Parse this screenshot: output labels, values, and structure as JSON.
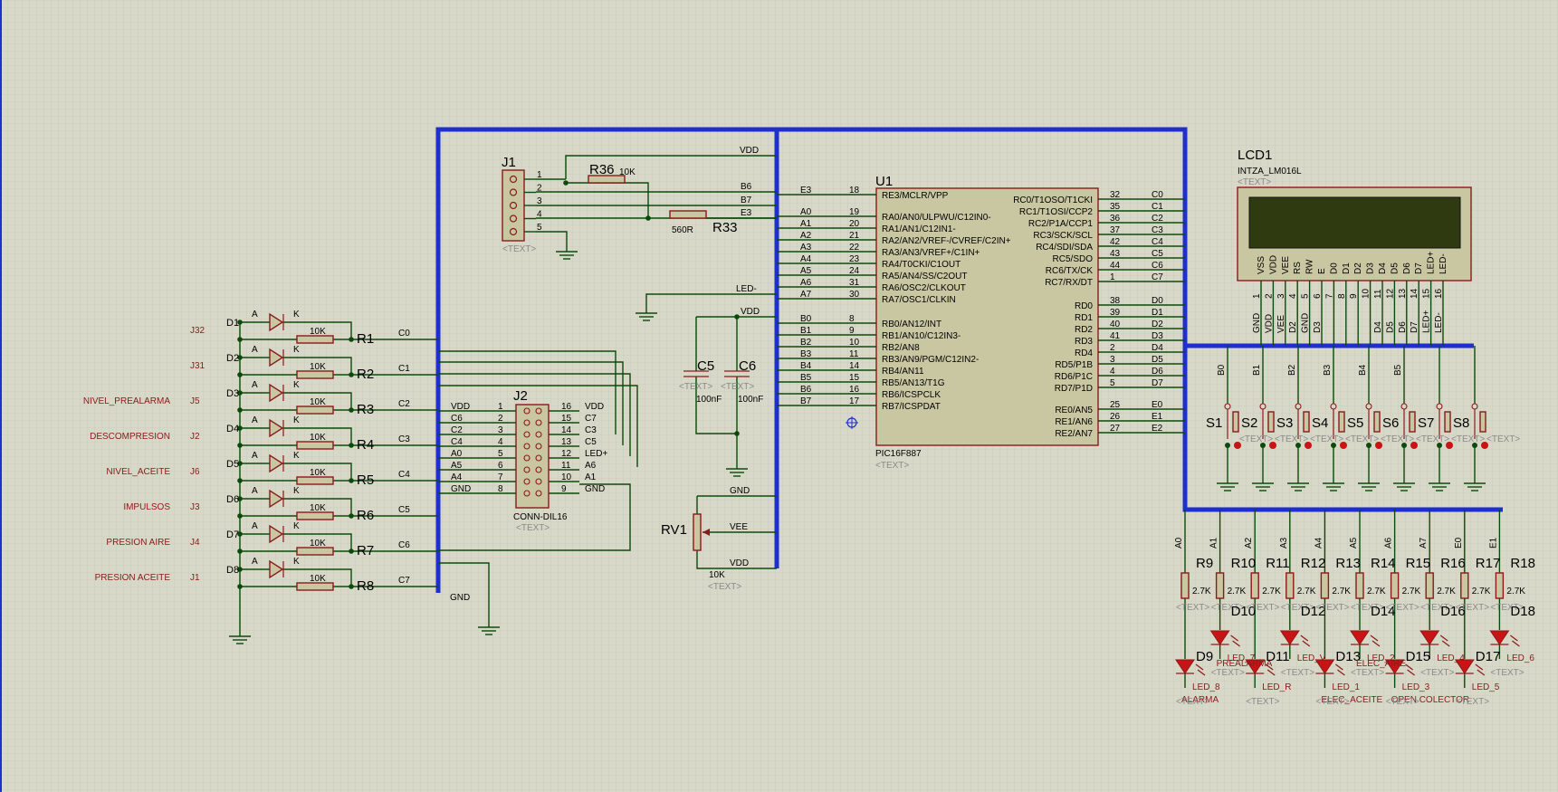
{
  "colors": {
    "background": "#d8d8c8",
    "grid": "#c3c3b3",
    "wire": "#0c4a0c",
    "bus": "#1f2fcf",
    "component": "#8b1a1a",
    "component_fill": "#c9c7a2",
    "lcd_screen": "#2f3a10",
    "label": "#8b1a1a"
  },
  "placeholder": "<TEXT>",
  "u1": {
    "ref": "U1",
    "part": "PIC16F887",
    "left_pins": [
      {
        "num": "18",
        "name": "RE3/MCLR/VPP",
        "net": "E3"
      },
      {
        "num": "19",
        "name": "RA0/AN0/ULPWU/C12IN0-",
        "net": "A0"
      },
      {
        "num": "20",
        "name": "RA1/AN1/C12IN1-",
        "net": "A1"
      },
      {
        "num": "21",
        "name": "RA2/AN2/VREF-/CVREF/C2IN+",
        "net": "A2"
      },
      {
        "num": "22",
        "name": "RA3/AN3/VREF+/C1IN+",
        "net": "A3"
      },
      {
        "num": "23",
        "name": "RA4/T0CKI/C1OUT",
        "net": "A4"
      },
      {
        "num": "24",
        "name": "RA5/AN4/SS/C2OUT",
        "net": "A5"
      },
      {
        "num": "31",
        "name": "RA6/OSC2/CLKOUT",
        "net": "A6"
      },
      {
        "num": "30",
        "name": "RA7/OSC1/CLKIN",
        "net": "A7"
      },
      {
        "num": "8",
        "name": "RB0/AN12/INT",
        "net": "B0"
      },
      {
        "num": "9",
        "name": "RB1/AN10/C12IN3-",
        "net": "B1"
      },
      {
        "num": "10",
        "name": "RB2/AN8",
        "net": "B2"
      },
      {
        "num": "11",
        "name": "RB3/AN9/PGM/C12IN2-",
        "net": "B3"
      },
      {
        "num": "14",
        "name": "RB4/AN11",
        "net": "B4"
      },
      {
        "num": "15",
        "name": "RB5/AN13/T1G",
        "net": "B5"
      },
      {
        "num": "16",
        "name": "RB6/ICSPCLK",
        "net": "B6"
      },
      {
        "num": "17",
        "name": "RB7/ICSPDAT",
        "net": "B7"
      }
    ],
    "right_pins": [
      {
        "num": "32",
        "name": "RC0/T1OSO/T1CKI",
        "net": "C0"
      },
      {
        "num": "35",
        "name": "RC1/T1OSI/CCP2",
        "net": "C1"
      },
      {
        "num": "36",
        "name": "RC2/P1A/CCP1",
        "net": "C2"
      },
      {
        "num": "37",
        "name": "RC3/SCK/SCL",
        "net": "C3"
      },
      {
        "num": "42",
        "name": "RC4/SDI/SDA",
        "net": "C4"
      },
      {
        "num": "43",
        "name": "RC5/SDO",
        "net": "C5"
      },
      {
        "num": "44",
        "name": "RC6/TX/CK",
        "net": "C6"
      },
      {
        "num": "1",
        "name": "RC7/RX/DT",
        "net": "C7"
      },
      {
        "num": "38",
        "name": "RD0",
        "net": "D0"
      },
      {
        "num": "39",
        "name": "RD1",
        "net": "D1"
      },
      {
        "num": "40",
        "name": "RD2",
        "net": "D2"
      },
      {
        "num": "41",
        "name": "RD3",
        "net": "D3"
      },
      {
        "num": "2",
        "name": "RD4",
        "net": "D4"
      },
      {
        "num": "3",
        "name": "RD5/P1B",
        "net": "D5"
      },
      {
        "num": "4",
        "name": "RD6/P1C",
        "net": "D6"
      },
      {
        "num": "5",
        "name": "RD7/P1D",
        "net": "D7"
      },
      {
        "num": "25",
        "name": "RE0/AN5",
        "net": "E0"
      },
      {
        "num": "26",
        "name": "RE1/AN6",
        "net": "E1"
      },
      {
        "num": "27",
        "name": "RE2/AN7",
        "net": "E2"
      }
    ]
  },
  "lcd": {
    "ref": "LCD1",
    "part": "INTZA_LM016L",
    "pins": [
      {
        "name": "VSS",
        "num": "1",
        "net": "GND"
      },
      {
        "name": "VDD",
        "num": "2",
        "net": "VDD"
      },
      {
        "name": "VEE",
        "num": "3",
        "net": "VEE"
      },
      {
        "name": "RS",
        "num": "4",
        "net": "D2"
      },
      {
        "name": "RW",
        "num": "5",
        "net": "GND"
      },
      {
        "name": "E",
        "num": "6",
        "net": "D3"
      },
      {
        "name": "D0",
        "num": "7",
        "net": ""
      },
      {
        "name": "D1",
        "num": "8",
        "net": ""
      },
      {
        "name": "D2",
        "num": "9",
        "net": ""
      },
      {
        "name": "D3",
        "num": "10",
        "net": ""
      },
      {
        "name": "D4",
        "num": "11",
        "net": "D4"
      },
      {
        "name": "D5",
        "num": "12",
        "net": "D5"
      },
      {
        "name": "D6",
        "num": "13",
        "net": "D6"
      },
      {
        "name": "D7",
        "num": "14",
        "net": "D7"
      },
      {
        "name": "LED+",
        "num": "15",
        "net": "LED+"
      },
      {
        "name": "LED-",
        "num": "16",
        "net": "LED-"
      }
    ]
  },
  "j1": {
    "ref": "J1",
    "pins": [
      "1",
      "2",
      "3",
      "4",
      "5"
    ],
    "nets": [
      "VDD",
      "B6",
      "B7",
      "E3"
    ],
    "r36": {
      "ref": "R36",
      "value": "10K"
    },
    "r33": {
      "ref": "R33",
      "value": "560R"
    },
    "net_led_minus": "LED-"
  },
  "j2": {
    "ref": "J2",
    "part": "CONN-DIL16",
    "rows": [
      {
        "ln": "VDD",
        "lp": "1",
        "rp": "16",
        "rn": "VDD"
      },
      {
        "ln": "C6",
        "lp": "2",
        "rp": "15",
        "rn": "C7"
      },
      {
        "ln": "C2",
        "lp": "3",
        "rp": "14",
        "rn": "C3"
      },
      {
        "ln": "C4",
        "lp": "4",
        "rp": "13",
        "rn": "C5"
      },
      {
        "ln": "A0",
        "lp": "5",
        "rp": "12",
        "rn": "LED+"
      },
      {
        "ln": "A5",
        "lp": "6",
        "rp": "11",
        "rn": "A6"
      },
      {
        "ln": "A4",
        "lp": "7",
        "rp": "10",
        "rn": "A1"
      },
      {
        "ln": "GND",
        "lp": "8",
        "rp": "9",
        "rn": "GND"
      }
    ]
  },
  "inputs": [
    {
      "d": "D1",
      "r": "R1",
      "net": "C0",
      "j": "J32",
      "label": ""
    },
    {
      "d": "D2",
      "r": "R2",
      "net": "C1",
      "j": "J31",
      "label": ""
    },
    {
      "d": "D3",
      "r": "R3",
      "net": "C2",
      "j": "J5",
      "label": "NIVEL_PREALARMA"
    },
    {
      "d": "D4",
      "r": "R4",
      "net": "C3",
      "j": "J2",
      "label": "DESCOMPRESION"
    },
    {
      "d": "D5",
      "r": "R5",
      "net": "C4",
      "j": "J6",
      "label": "NIVEL_ACEITE"
    },
    {
      "d": "D6",
      "r": "R6",
      "net": "C5",
      "j": "J3",
      "label": "IMPULSOS"
    },
    {
      "d": "D7",
      "r": "R7",
      "net": "C6",
      "j": "J4",
      "label": "PRESION AIRE"
    },
    {
      "d": "D8",
      "r": "R8",
      "net": "C7",
      "j": "J1",
      "label": "PRESION ACEITE"
    }
  ],
  "input_res_value": "10K",
  "diode_anode": "A",
  "diode_cathode": "K",
  "caps": [
    {
      "ref": "C5",
      "value": "100nF"
    },
    {
      "ref": "C6",
      "value": "100nF"
    }
  ],
  "rv1": {
    "ref": "RV1",
    "value": "10K",
    "nets": [
      "GND",
      "VEE",
      "VDD"
    ]
  },
  "net_vdd": "VDD",
  "net_gnd": "GND",
  "switches": [
    {
      "ref": "S1",
      "net": "B0"
    },
    {
      "ref": "S2",
      "net": "B1"
    },
    {
      "ref": "S3",
      "net": "B2"
    },
    {
      "ref": "S4",
      "net": "B3"
    },
    {
      "ref": "S5",
      "net": "B4"
    },
    {
      "ref": "S6",
      "net": "B5"
    },
    {
      "ref": "S7",
      "net": ""
    },
    {
      "ref": "S8",
      "net": ""
    }
  ],
  "leds": [
    {
      "r": "R9",
      "d": "D9",
      "net": "A0",
      "label": "LED_8",
      "sub": "ALARMA"
    },
    {
      "r": "R10",
      "d": "D10",
      "net": "A1",
      "label": "LED_7",
      "sub": "PREALARMA"
    },
    {
      "r": "R11",
      "d": "D11",
      "net": "A2",
      "label": "LED_R",
      "sub": ""
    },
    {
      "r": "R12",
      "d": "D12",
      "net": "A3",
      "label": "LED_V",
      "sub": ""
    },
    {
      "r": "R13",
      "d": "D13",
      "net": "A4",
      "label": "LED_1",
      "sub": "ELEC_ACEITE"
    },
    {
      "r": "R14",
      "d": "D14",
      "net": "A5",
      "label": "LED_2",
      "sub": "ELEC_AIRE"
    },
    {
      "r": "R15",
      "d": "D15",
      "net": "A6",
      "label": "LED_3",
      "sub": "OPEN COLECTOR"
    },
    {
      "r": "R16",
      "d": "D16",
      "net": "A7",
      "label": "LED_4",
      "sub": ""
    },
    {
      "r": "R17",
      "d": "D17",
      "net": "E0",
      "label": "LED_5",
      "sub": ""
    },
    {
      "r": "R18",
      "d": "D18",
      "net": "E1",
      "label": "LED_6",
      "sub": ""
    }
  ],
  "led_res_value": "2.7K"
}
